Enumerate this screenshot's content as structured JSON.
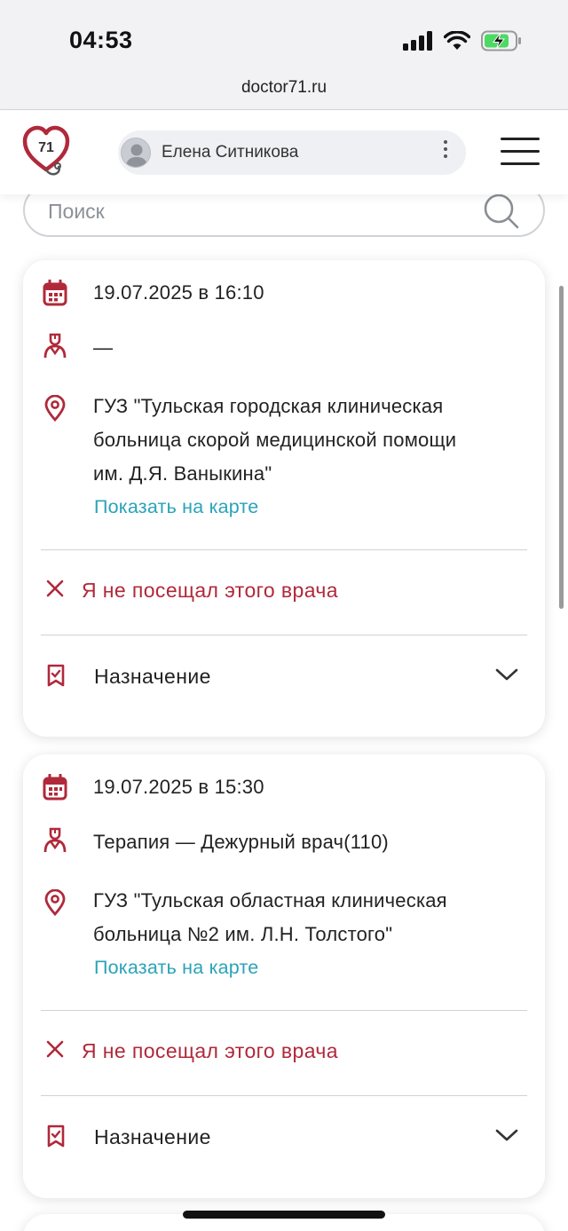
{
  "status": {
    "time": "04:53"
  },
  "browser": {
    "url": "doctor71.ru"
  },
  "header": {
    "logo_text": "71",
    "user_name": "Елена Ситникова",
    "kebab": "⋮"
  },
  "search": {
    "placeholder": "Поиск"
  },
  "visits": [
    {
      "datetime": "19.07.2025 в 16:10",
      "specialty": "—",
      "org_lines": [
        "ГУЗ \"Тульская городская клиническая",
        "больница скорой медицинской помощи",
        "им. Д.Я. Ваныкина\""
      ],
      "map_link": "Показать на карте",
      "not_visited": "Я не посещал этого врача",
      "assignment": "Назначение"
    },
    {
      "datetime": "19.07.2025 в 15:30",
      "specialty": "Терапия — Дежурный врач(110)",
      "org_lines": [
        "ГУЗ \"Тульская областная клиническая",
        "больница №2 им. Л.Н. Толстого\""
      ],
      "map_link": "Показать на карте",
      "not_visited": "Я не посещал этого врача",
      "assignment": "Назначение"
    }
  ],
  "colors": {
    "brand_red": "#b0293a",
    "link_teal": "#2aa3b8"
  }
}
